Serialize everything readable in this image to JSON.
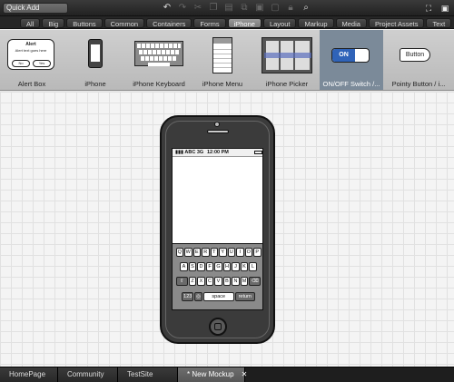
{
  "toolbar": {
    "quick_add_value": "Quick Add",
    "icons": [
      "undo-icon",
      "redo-icon",
      "cut-icon",
      "copy-icon",
      "paste-icon",
      "duplicate-icon",
      "group-icon",
      "ungroup-icon",
      "lock-icon",
      "search-icon"
    ],
    "right_icons": [
      "fullscreen-icon",
      "present-icon"
    ]
  },
  "categories": [
    {
      "label": "All"
    },
    {
      "label": "Big"
    },
    {
      "label": "Buttons"
    },
    {
      "label": "Common"
    },
    {
      "label": "Containers"
    },
    {
      "label": "Forms"
    },
    {
      "label": "iPhone",
      "active": true
    },
    {
      "label": "Layout"
    },
    {
      "label": "Markup"
    },
    {
      "label": "Media"
    },
    {
      "label": "Project Assets"
    },
    {
      "label": "Text"
    }
  ],
  "components": [
    {
      "label": "Alert Box",
      "alert_title": "Alert",
      "alert_body": "Alert text goes here",
      "btn_no": "No",
      "btn_yes": "Yes"
    },
    {
      "label": "iPhone"
    },
    {
      "label": "iPhone Keyboard"
    },
    {
      "label": "iPhone Menu"
    },
    {
      "label": "iPhone Picker"
    },
    {
      "label": "ON/OFF Switch /...",
      "selected": true,
      "switch_text": "ON"
    },
    {
      "label": "Pointy Button / i...",
      "button_text": "Button"
    }
  ],
  "phone": {
    "carrier": "ABC",
    "network": "3G",
    "time": "12:00 PM",
    "keyboard": {
      "row1": [
        "Q",
        "W",
        "E",
        "R",
        "T",
        "Y",
        "U",
        "I",
        "O",
        "P"
      ],
      "row2": [
        "A",
        "S",
        "D",
        "F",
        "G",
        "H",
        "J",
        "K",
        "L"
      ],
      "row3": [
        "⇧",
        "Z",
        "X",
        "C",
        "V",
        "B",
        "N",
        "M",
        "⌫"
      ],
      "row4": {
        "numbers": "123",
        "globe": "◎",
        "space": "space",
        "return": "return"
      }
    }
  },
  "tabs": [
    {
      "label": "HomePage"
    },
    {
      "label": "Community"
    },
    {
      "label": "TestSite"
    },
    {
      "label": "* New Mockup",
      "active": true,
      "close": "✕"
    }
  ],
  "colors": {
    "selected_item": "#7b8a99",
    "switch_on": "#2f63b8"
  }
}
